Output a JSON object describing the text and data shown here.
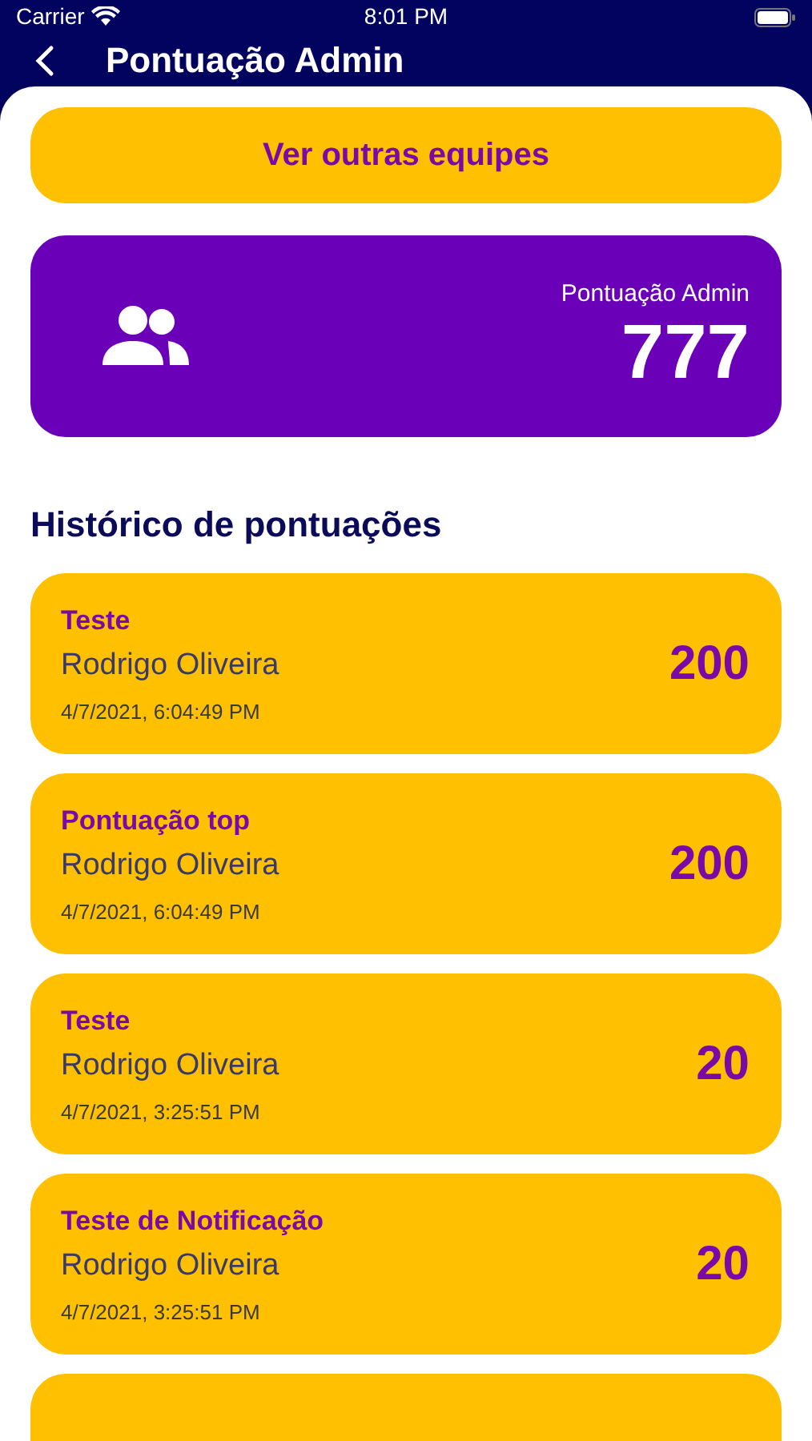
{
  "status_bar": {
    "carrier": "Carrier",
    "time": "8:01 PM"
  },
  "nav": {
    "title": "Pontuação Admin"
  },
  "other_teams_button": "Ver outras equipes",
  "score_card": {
    "label": "Pontuação Admin",
    "value": "777"
  },
  "history": {
    "title": "Histórico de pontuações",
    "items": [
      {
        "title": "Teste",
        "user": "Rodrigo Oliveira",
        "date": "4/7/2021, 6:04:49 PM",
        "points": "200"
      },
      {
        "title": "Pontuação top",
        "user": "Rodrigo Oliveira",
        "date": "4/7/2021, 6:04:49 PM",
        "points": "200"
      },
      {
        "title": "Teste",
        "user": "Rodrigo Oliveira",
        "date": "4/7/2021, 3:25:51 PM",
        "points": "20"
      },
      {
        "title": "Teste de Notificação",
        "user": "Rodrigo Oliveira",
        "date": "4/7/2021, 3:25:51 PM",
        "points": "20"
      }
    ]
  }
}
